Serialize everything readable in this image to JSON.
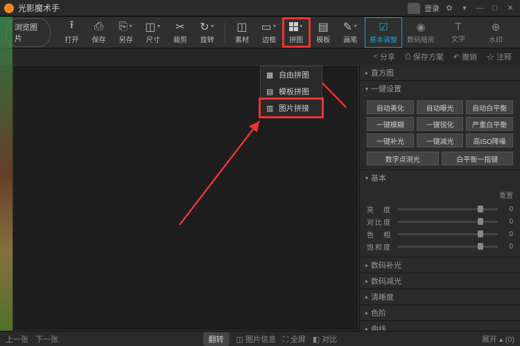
{
  "title": "光影魔术手",
  "titlebar": {
    "login": "登录"
  },
  "toolbar": {
    "browse": "浏览图片",
    "items": [
      {
        "label": "打开",
        "glyph": "📂"
      },
      {
        "label": "保存",
        "glyph": "💾"
      },
      {
        "label": "另存",
        "glyph": "💾"
      },
      {
        "label": "尺寸",
        "glyph": "⬚"
      },
      {
        "label": "裁剪",
        "glyph": "✂"
      },
      {
        "label": "旋转",
        "glyph": "↻"
      }
    ],
    "items2": [
      {
        "label": "素材",
        "glyph": "◫"
      },
      {
        "label": "边框",
        "glyph": "▭"
      },
      {
        "label": "拼图",
        "glyph": "▦"
      },
      {
        "label": "模板",
        "glyph": "▤"
      },
      {
        "label": "画笔",
        "glyph": "✎"
      }
    ],
    "tabs": [
      {
        "label": "基本调整",
        "glyph": "☑"
      },
      {
        "label": "数码暗房",
        "glyph": "◉"
      },
      {
        "label": "文字",
        "glyph": "T"
      },
      {
        "label": "水印",
        "glyph": "⊕"
      }
    ]
  },
  "secondbar": {
    "share": "分享",
    "saveas": "保存方案",
    "undo": "撤销",
    "comment": "☆ 注释"
  },
  "dropdown": {
    "free": "自由拼图",
    "template": "模板拼图",
    "stitch": "图片拼接"
  },
  "panel": {
    "histogram": "直方图",
    "oneclick": {
      "title": "一键设置",
      "buttons": [
        "自动美化",
        "自动曝光",
        "自动白平衡",
        "一键模糊",
        "一键锐化",
        "严重白平衡",
        "一键补光",
        "一键减光",
        "高ISO降噪"
      ],
      "row2": [
        "数字点测光",
        "白平衡一指键"
      ]
    },
    "basic": {
      "title": "基本",
      "reset": "重置",
      "sliders": [
        {
          "label": "亮　度",
          "val": "0",
          "pos": 80
        },
        {
          "label": "对比度",
          "val": "0",
          "pos": 80
        },
        {
          "label": "色　相",
          "val": "0",
          "pos": 80
        },
        {
          "label": "饱和度",
          "val": "0",
          "pos": 80
        }
      ]
    },
    "sections": [
      "数码补光",
      "数码减光",
      "清晰度",
      "色阶",
      "曲线"
    ]
  },
  "status": {
    "prev": "上一张",
    "next": "下一张",
    "upload": "翻转",
    "info": "图片信息",
    "fullscreen": "全屏",
    "compare": "对比",
    "expand": "展开",
    "size": "(0)"
  }
}
